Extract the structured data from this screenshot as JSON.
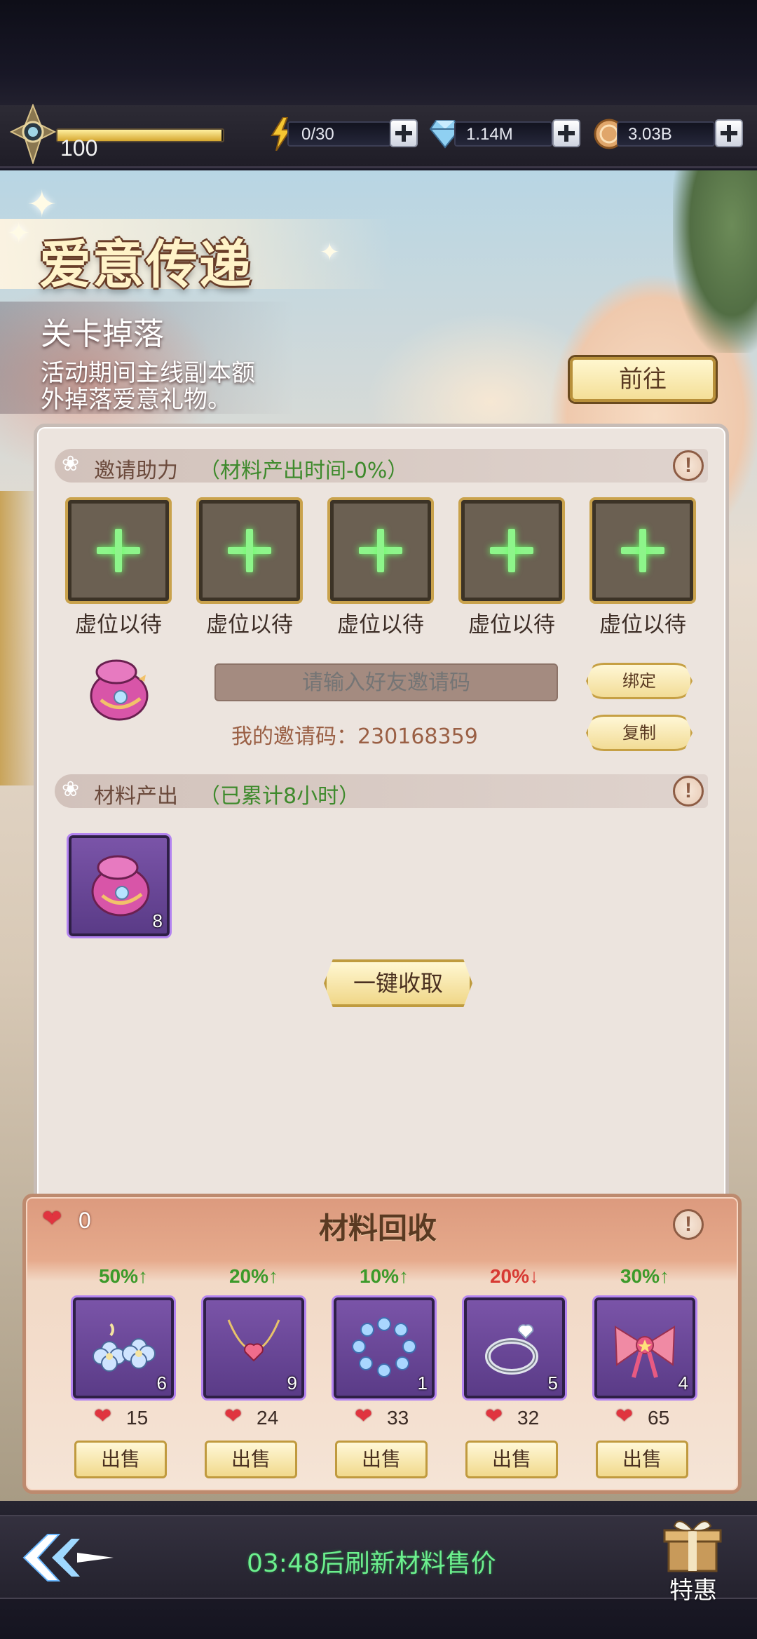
{
  "status_bar": {
    "level": "100",
    "xp_fraction": 0.99,
    "energy": "0/30",
    "diamonds": "1.14M",
    "coins": "3.03B"
  },
  "event": {
    "title": "爱意传递",
    "drop_title": "关卡掉落",
    "drop_desc_line1": "活动期间主线副本额",
    "drop_desc_line2": "外掉落爱意礼物。",
    "goto_label": "前往"
  },
  "invite": {
    "title": "邀请助力",
    "note": "（材料产出时间-0%）",
    "slot_labels": [
      "虚位以待",
      "虚位以待",
      "虚位以待",
      "虚位以待",
      "虚位以待"
    ],
    "input_placeholder": "请输入好友邀请码",
    "bind_label": "绑定",
    "copy_label": "复制",
    "my_code_label": "我的邀请码：230168359"
  },
  "output": {
    "title": "材料产出",
    "note": "（已累计8小时）",
    "item_count": "8",
    "collect_label": "一键收取"
  },
  "recycle": {
    "title": "材料回收",
    "heart_total": "0",
    "items": [
      {
        "icon": "earrings-icon",
        "change": "50%↑",
        "direction": "up",
        "count": "6",
        "price": "15",
        "sell_label": "出售"
      },
      {
        "icon": "necklace-icon",
        "change": "20%↑",
        "direction": "up",
        "count": "9",
        "price": "24",
        "sell_label": "出售"
      },
      {
        "icon": "bracelet-icon",
        "change": "10%↑",
        "direction": "up",
        "count": "1",
        "price": "33",
        "sell_label": "出售"
      },
      {
        "icon": "ring-icon",
        "change": "20%↓",
        "direction": "down",
        "count": "5",
        "price": "32",
        "sell_label": "出售"
      },
      {
        "icon": "bow-icon",
        "change": "30%↑",
        "direction": "up",
        "count": "4",
        "price": "65",
        "sell_label": "出售"
      }
    ]
  },
  "footer": {
    "refresh_text": "03:48后刷新材料售价",
    "special_label": "特惠"
  },
  "colors": {
    "price_up": "#3c9a2a",
    "price_down": "#d73a33",
    "timer_green": "#6cf08e",
    "item_frame": "#7a54a8"
  }
}
